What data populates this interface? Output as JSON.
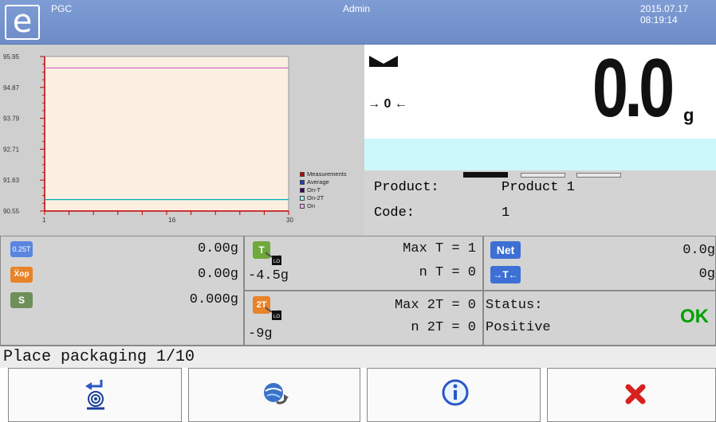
{
  "header": {
    "app_name": "PGC",
    "user": "Admin",
    "date": "2015.07.17",
    "time": "08:19:14"
  },
  "chart_data": {
    "type": "line",
    "y_ticks": [
      "95.95",
      "94.87",
      "93.79",
      "92.71",
      "91.63",
      "90.55"
    ],
    "x_ticks": [
      "1",
      "16",
      "30"
    ],
    "ylim": [
      90.55,
      95.95
    ],
    "xlim": [
      1,
      30
    ],
    "series": [
      {
        "name": "Measurements",
        "color": "#c00000",
        "values": []
      },
      {
        "name": "Average",
        "color": "#2040c0",
        "values": []
      },
      {
        "name": "On-T",
        "color": "#400060",
        "values": []
      },
      {
        "name": "On-2T",
        "color": "#00b0b0",
        "values": [],
        "constant": 90.95
      },
      {
        "name": "On",
        "color": "#d070d0",
        "values": [],
        "constant": 95.55
      }
    ],
    "legend": [
      "Measurements",
      "Average",
      "On-T",
      "On-2T",
      "On"
    ],
    "legend_position": "right"
  },
  "display": {
    "zero_symbol": "→ 0 ←",
    "weight": "0.0",
    "unit": "g"
  },
  "product": {
    "product_label": "Product:",
    "product_value": "Product 1",
    "code_label": "Code:",
    "code_value": "1"
  },
  "stats": {
    "badge_025t": "0.25T",
    "val_025t": "0.00g",
    "badge_xop": "X̅op",
    "val_xop": "0.00g",
    "badge_s": "S",
    "val_s": "0.000g"
  },
  "tolerance": {
    "t_badge": "T",
    "t_value": "-4.5g",
    "max_t": "Max T = 1",
    "n_t": "n T = 0",
    "t2_badge": "2T",
    "t2_value": "-9g",
    "max_2t": "Max 2T = 0",
    "n_2t": "n 2T = 0"
  },
  "net": {
    "net_badge": "Net",
    "net_value": "0.0g",
    "tare_badge": "→T←",
    "tare_value": "0g",
    "status_label": "Status:",
    "status_value": "Positive",
    "ok_label": "OK"
  },
  "message": "Place packaging 1/10",
  "colors": {
    "header": "#7f9dd4",
    "chart_bg": "#fbefe1",
    "display_cyan": "#ccf8fb",
    "ok_green": "#00a000",
    "badge_blue": "#3d6fd4",
    "badge_orange": "#e8832a",
    "badge_green": "#6f9a3b"
  },
  "buttons": [
    {
      "icon": "tare-enter-icon"
    },
    {
      "icon": "refresh-globe-icon"
    },
    {
      "icon": "info-icon"
    },
    {
      "icon": "close-icon"
    }
  ]
}
